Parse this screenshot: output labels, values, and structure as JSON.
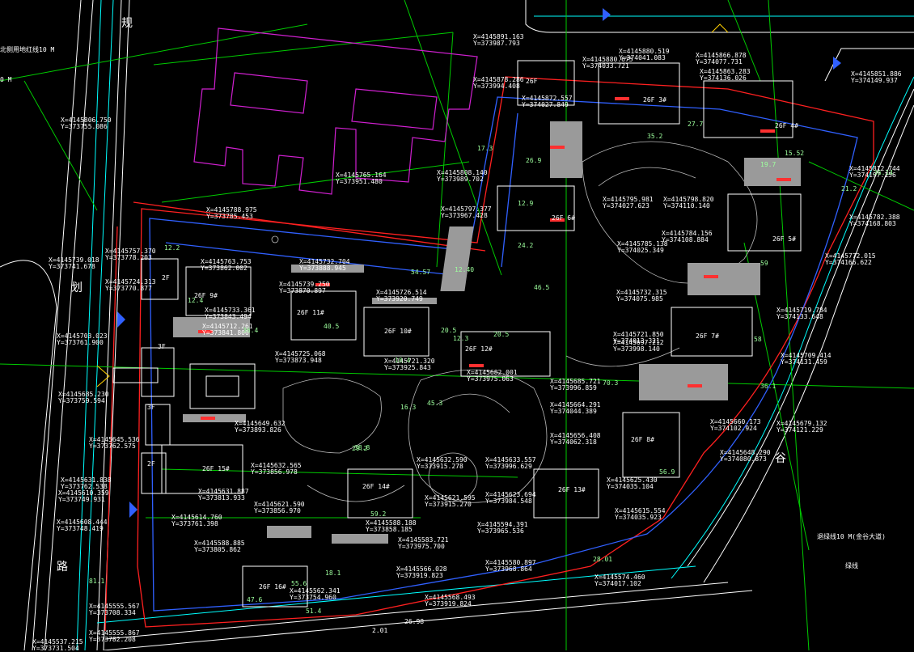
{
  "colors": {
    "background": "#000000",
    "road_line": "#ffffff",
    "green_line": "#00ff00",
    "blue_line": "#3060ff",
    "cyan_line": "#00ffff",
    "red_line": "#ff2020",
    "magenta_line": "#d020d0",
    "gray_fill": "#9a9a9a",
    "text": "#ffffff"
  },
  "street_chars": [
    "规",
    "划",
    "路",
    "谷"
  ],
  "road_labels": {
    "north_redline": "北侧用地红线10 M",
    "left_partial": "0 M",
    "east_redline": "退绿线10 M(金谷大道)",
    "east_extra": "绿线",
    "south_edge": "2.01",
    "south_edge_2": "26.98"
  },
  "buildings": [
    {
      "id": "b1",
      "label": "26F"
    },
    {
      "id": "b2",
      "label": "26F 3#"
    },
    {
      "id": "b3",
      "label": "26F 4#"
    },
    {
      "id": "b4",
      "label": "26F 6#"
    },
    {
      "id": "b5",
      "label": "26F 5#"
    },
    {
      "id": "b6",
      "label": "26F 7#"
    },
    {
      "id": "b7",
      "label": "26F 8#"
    },
    {
      "id": "b8",
      "label": "26F 13#"
    },
    {
      "id": "b9",
      "label": "26F 14#"
    },
    {
      "id": "b10",
      "label": "26F 15#"
    },
    {
      "id": "b11",
      "label": "26F 16#"
    },
    {
      "id": "b12",
      "label": "26F 12#"
    },
    {
      "id": "b13",
      "label": "26F 10#"
    },
    {
      "id": "b14",
      "label": "26F 11#"
    },
    {
      "id": "b15",
      "label": "26F 9#"
    },
    {
      "id": "b16",
      "label": "2F"
    },
    {
      "id": "b17",
      "label": "3F"
    },
    {
      "id": "b18",
      "label": "2F"
    },
    {
      "id": "b19",
      "label": "3F"
    }
  ],
  "coordinates": [
    "X=4145891.163 Y=373987.793",
    "X=4145880.519 Y=374041.083",
    "X=4145880.675 Y=374033.721",
    "X=4145866.878 Y=374077.731",
    "X=4145878.286 Y=373994.408",
    "X=4145863.283 Y=374136.026",
    "X=4145851.886 Y=374149.937",
    "X=4145806.750 Y=373755.086",
    "X=4145872.557 Y=374027.849",
    "X=4145808.140 Y=373989.702",
    "X=4145765.164 Y=373951.480",
    "X=4145797.377 Y=373967.428",
    "X=4145788.975 Y=373785.453",
    "X=4145795.981 Y=374027.623",
    "X=4145798.820 Y=374110.140",
    "X=4145812.744 Y=374197.156",
    "X=4145782.388 Y=374168.803",
    "X=4145757.370 Y=373778.203",
    "X=4145739.018 Y=373741.678",
    "X=4145763.753 Y=373862.002",
    "X=4145732.704 Y=373888.945",
    "X=4145785.138 Y=374025.349",
    "X=4145784.156 Y=374108.884",
    "X=4145772.015 Y=374166.622",
    "X=4145724.313 Y=373770.877",
    "X=4145739.250 Y=373870.897",
    "X=4145726.514 Y=373920.749",
    "X=4145732.315 Y=374075.985",
    "X=4145719.784 Y=374133.648",
    "X=4145703.023 Y=373761.900",
    "X=4145733.361 Y=373843.494",
    "X=4145712.261 Y=373841.800",
    "X=4145697.212 Y=373998.140",
    "X=4145721.850 Y=374013.321",
    "X=4145709.414 Y=374131.459",
    "X=4145725.068 Y=373873.948",
    "X=4145721.320 Y=373925.843",
    "X=4145682.001 Y=373975.063",
    "X=4145685.721 Y=373996.859",
    "X=4145685.230 Y=373759.594",
    "X=4145664.291 Y=374044.389",
    "X=4145660.173 Y=374102.924",
    "X=4145679.132 Y=374121.229",
    "X=4145645.536 Y=373762.575",
    "X=4145649.632 Y=373893.826",
    "X=4145656.408 Y=374062.318",
    "X=4145648.290 Y=374080.873",
    "X=4145632.590 Y=373915.278",
    "X=4145633.557 Y=373996.629",
    "X=4145632.565 Y=373856.978",
    "X=4145625.430 Y=374035.104",
    "X=4145631.838 Y=373762.538",
    "X=4145610.359 Y=373749.931",
    "X=4145631.887 Y=373813.933",
    "X=4145621.595 Y=373915.270",
    "X=4145623.694 Y=373984.548",
    "X=4145608.444 Y=373748.419",
    "X=4145614.760 Y=373761.398",
    "X=4145621.590 Y=373856.970",
    "X=4145615.554 Y=374035.923",
    "X=4145588.885 Y=373805.862",
    "X=4145588.188 Y=373858.185",
    "X=4145594.391 Y=373965.536",
    "X=4145583.721 Y=373975.700",
    "X=4145566.028 Y=373919.823",
    "X=4145580.897 Y=373968.864",
    "X=4145574.460 Y=374017.102",
    "X=4145555.567 Y=373708.334",
    "X=4145562.341 Y=373754.960",
    "X=4145568.493 Y=373919.824",
    "X=4145537.215 Y=373731.504",
    "X=4145555.867 Y=373782.208"
  ],
  "dims": [
    "12.2",
    "12.4",
    "17.3",
    "12.40",
    "54.57",
    "20.5",
    "12.9",
    "59",
    "35.2",
    "27.7",
    "19.7",
    "20.5",
    "58",
    "46.5",
    "16.3",
    "59.2",
    "51.4",
    "28.01",
    "70.3",
    "29.2",
    "36.4",
    "45.3",
    "36.14",
    "21.2",
    "15.52",
    "40.5",
    "38.8",
    "56.9",
    "18.1",
    "18.4",
    "12.3",
    "36.1",
    "55.6",
    "47.6",
    "81.1",
    "24.2",
    "26.9"
  ]
}
